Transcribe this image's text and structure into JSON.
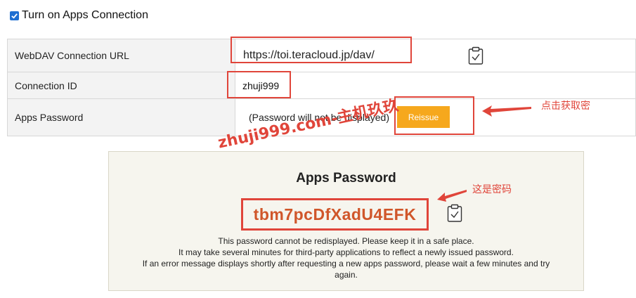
{
  "connection_toggle": {
    "label": "Turn on Apps Connection",
    "checked": true
  },
  "settings": {
    "webdav_label": "WebDAV Connection URL",
    "webdav_url": "https://toi.teracloud.jp/dav/",
    "connection_id_label": "Connection ID",
    "connection_id": "zhuji999",
    "apps_password_label": "Apps Password",
    "apps_password_note": "(Password will not be displayed)",
    "reissue_label": "Reissue"
  },
  "panel": {
    "title": "Apps Password",
    "password": "tbm7pcDfXadU4EFK",
    "message_lines": [
      "This password cannot be redisplayed. Please keep it in a safe place.",
      "It may take several minutes for third-party applications to reflect a newly issued password.",
      "If an error message displays shortly after requesting a new apps password, please wait a few minutes and try",
      "again."
    ]
  },
  "annotations": {
    "click_to_get": "点击获取密",
    "this_is_password": "这是密码",
    "watermark": "zhuji999.com-主机玖玖"
  },
  "colors": {
    "accent_red": "#e0453a",
    "button_orange": "#f6a81d",
    "password_text": "#d0562a",
    "checkbox_blue": "#1f6fd1"
  },
  "icons": [
    "checkbox-check-icon",
    "clipboard-icon",
    "arrow-left-icon"
  ]
}
